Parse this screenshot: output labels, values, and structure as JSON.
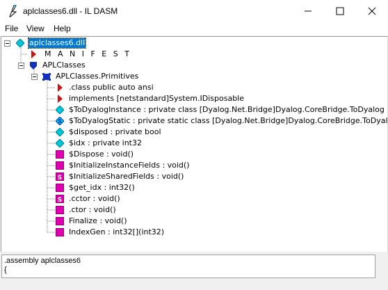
{
  "window": {
    "title": "aplclasses6.dll - IL DASM"
  },
  "menu": [
    "File",
    "View",
    "Help"
  ],
  "tree": [
    {
      "label": "aplclasses6.dll",
      "icon": "diamond-cyan-icon",
      "selected": true
    },
    {
      "label": "M A N I F E S T",
      "icon": "red-triangle-icon"
    },
    {
      "label": "APLClasses",
      "icon": "blue-shield-icon"
    },
    {
      "label": "APLClasses.Primitives",
      "icon": "class-icon"
    },
    {
      "label": ".class public auto ansi",
      "icon": "red-triangle-icon"
    },
    {
      "label": "implements [netstandard]System.IDisposable",
      "icon": "red-triangle-icon"
    },
    {
      "label": "$ToDyalogInstance : private class [Dyalog.Net.Bridge]Dyalog.CoreBridge.ToDyalog",
      "icon": "field-icon"
    },
    {
      "label": "$ToDyalogStatic : private static class [Dyalog.Net.Bridge]Dyalog.CoreBridge.ToDyalog",
      "icon": "static-field-icon"
    },
    {
      "label": "$disposed : private bool",
      "icon": "field-icon"
    },
    {
      "label": "$idx : private int32",
      "icon": "field-icon"
    },
    {
      "label": "$Dispose : void()",
      "icon": "method-icon"
    },
    {
      "label": "$InitializeInstanceFields : void()",
      "icon": "method-icon"
    },
    {
      "label": "$InitializeSharedFields : void()",
      "icon": "static-method-icon"
    },
    {
      "label": "$get_idx : int32()",
      "icon": "method-icon"
    },
    {
      "label": ".cctor : void()",
      "icon": "static-method-icon"
    },
    {
      "label": ".ctor : void()",
      "icon": "method-icon"
    },
    {
      "label": "Finalize : void()",
      "icon": "method-icon"
    },
    {
      "label": "IndexGen : int32[](int32)",
      "icon": "method-icon"
    }
  ],
  "bottom": {
    "line1": ".assembly aplclasses6",
    "line2": "{"
  },
  "colors": {
    "selection": "#0078d7",
    "method": "#e000b0",
    "field": "#00c8d8",
    "triangle": "#d01010",
    "namespace": "#1030c0"
  }
}
